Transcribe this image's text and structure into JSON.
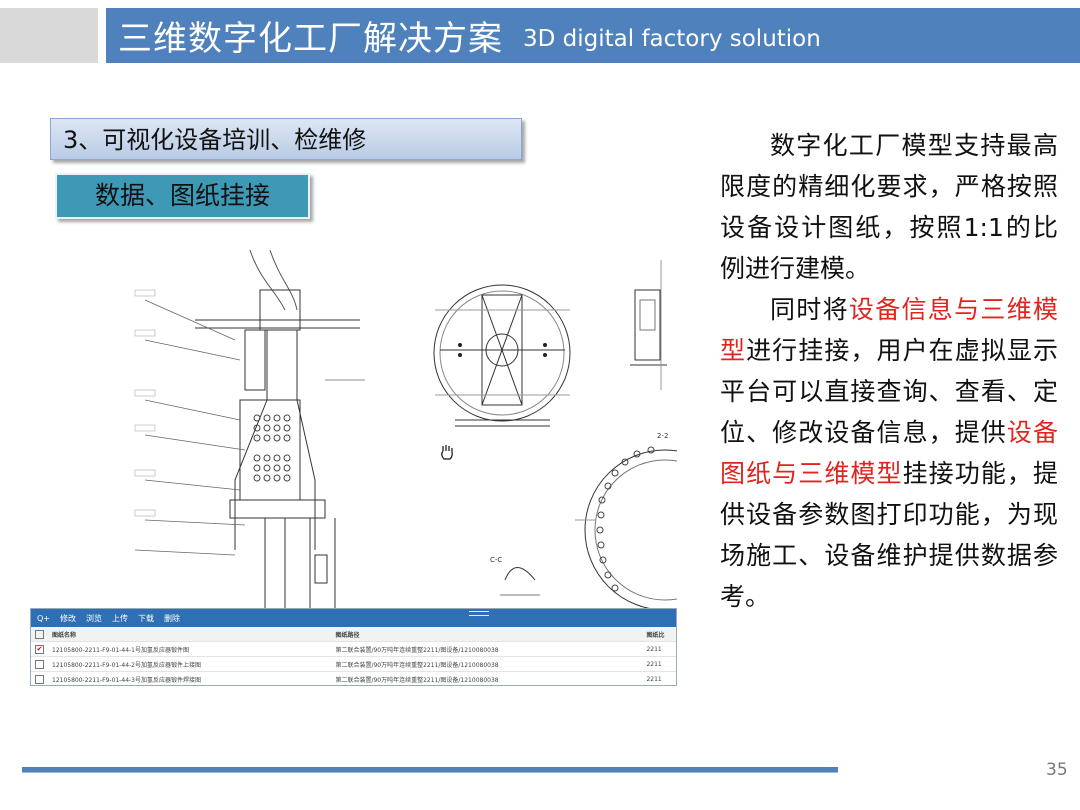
{
  "header": {
    "title_cn": "三维数字化工厂解决方案",
    "title_en": "3D digital factory solution"
  },
  "section": {
    "heading": "3、可视化设备培训、检维修",
    "subheading": "数据、图纸挂接"
  },
  "drawing_labels": [
    "2-2",
    "C-C"
  ],
  "table": {
    "toolbar": [
      "Q+",
      "修改",
      "浏览",
      "上传",
      "下载",
      "删除"
    ],
    "columns": [
      "图纸名称",
      "图纸路径",
      "图纸比"
    ],
    "rows": [
      {
        "checked": true,
        "name": "12105800-2211-F9-01-44-1号加氢反应器锻件图",
        "path": "第二联合装置/90万吨年连续重整2211/图设备/1210080038",
        "ratio": "2211"
      },
      {
        "checked": false,
        "name": "12105800-2211-F9-01-44-2号加氢反应器锻件上接图",
        "path": "第二联合装置/90万吨年连续重整2211/图设备/1210080038",
        "ratio": "2211"
      },
      {
        "checked": false,
        "name": "12105800-2211-F9-01-44-3号加氢反应器锻件焊接图",
        "path": "第二联合装置/90万吨年连续重整2211/图设备/1210080038",
        "ratio": "2211"
      }
    ]
  },
  "description": {
    "para1": "数字化工厂模型支持最高限度的精细化要求，严格按照设备设计图纸，按照1:1的比例进行建模。",
    "para2_a": "同时将",
    "para2_red1": "设备信息与三维模型",
    "para2_b": "进行挂接，用户在虚拟显示平台可以直接查询、查看、定位、修改设备信息，提供",
    "para2_red2": "设备图纸与三维模型",
    "para2_c": "挂接功能，提供设备参数图打印功能，为现场施工、设备维护提供数据参考。"
  },
  "page_number": "35",
  "colors": {
    "title_bar": "#4f81bd",
    "subheading_bg": "#3d99b6",
    "highlight": "#e0251f"
  }
}
